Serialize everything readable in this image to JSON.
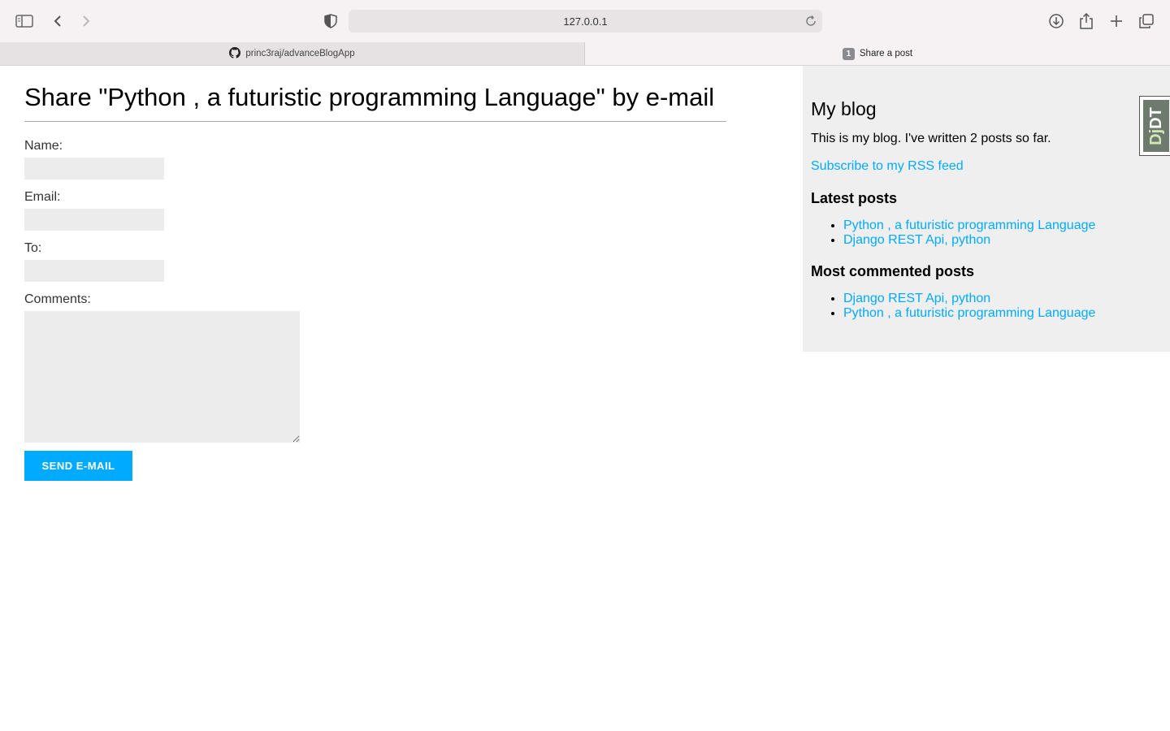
{
  "browser": {
    "url": "127.0.0.1",
    "tabs": [
      {
        "label": "princ3raj/advanceBlogApp",
        "icon": "github-icon"
      },
      {
        "label": "Share a post",
        "badge": "1"
      }
    ]
  },
  "share": {
    "title": "Share \"Python , a futuristic programming Language\" by e-mail",
    "fields": {
      "name_label": "Name:",
      "email_label": "Email:",
      "to_label": "To:",
      "comments_label": "Comments:"
    },
    "send_label": "Send e-mail"
  },
  "sidebar": {
    "title": "My blog",
    "description": "This is my blog. I've written 2 posts so far.",
    "rss_link": "Subscribe to my RSS feed",
    "latest_heading": "Latest posts",
    "latest": [
      "Python , a futuristic programming Language",
      "Django REST Api, python"
    ],
    "most_commented_heading": "Most commented posts",
    "most_commented": [
      "Django REST Api, python",
      "Python , a futuristic programming Language"
    ]
  },
  "debug_toolbar": {
    "label_dj": "Dj",
    "label_dt": "DT"
  },
  "colors": {
    "accent": "#00abff",
    "sidebar_bg": "#efefef",
    "input_bg": "#ececec"
  }
}
